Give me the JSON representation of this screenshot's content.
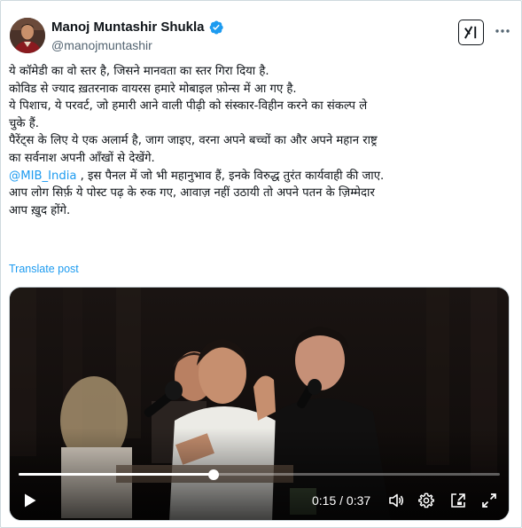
{
  "author": {
    "name": "Manoj Muntashir Shukla",
    "handle": "@manojmuntashir",
    "verified": true
  },
  "tweet": {
    "lines": [
      "ये कॉमेडी का वो स्तर है, जिसने मानवता का स्तर गिरा दिया है.",
      "कोविड से ज्याद ख़तरनाक वायरस हमारे मोबाइल फ़ोन्स में आ गए  है.",
      "ये पिशाच, ये परवर्ट,  जो हमारी आने वाली पीढ़ी को संस्कार-विहीन करने का संकल्प ले",
      "चुके हैं.",
      "पैरेंट्स के लिए ये एक अलार्म है, जाग जाइए, वरना अपने बच्चों का और अपने महान राष्ट्र",
      "का सर्वनाश अपनी आँखों से देखेंगे."
    ],
    "mention": "@MIB_India",
    "mention_line_rest": " , इस पैनल में जो भी महानुभाव हैं, इनके विरुद्ध तुरंत कार्यवाही की जाए.",
    "closing_lines": [
      "आप लोग सिर्फ़ ये पोस्ट पढ़ के रुक गए, आवाज़ नहीं उठायी तो अपने पतन के ज़िम्मेदार",
      "आप ख़ुद होंगे."
    ],
    "translate_label": "Translate post"
  },
  "video": {
    "current_time": "0:15",
    "separator": " / ",
    "duration": "0:37",
    "progress": 0.405
  },
  "colors": {
    "accent": "#1d9bf0",
    "text": "#0f1419",
    "muted": "#536471",
    "border": "#cfd9de"
  },
  "icons": [
    "verified-badge-icon",
    "grok-icon",
    "more-options-icon",
    "play-icon",
    "volume-icon",
    "settings-gear-icon",
    "pip-icon",
    "fullscreen-icon"
  ]
}
